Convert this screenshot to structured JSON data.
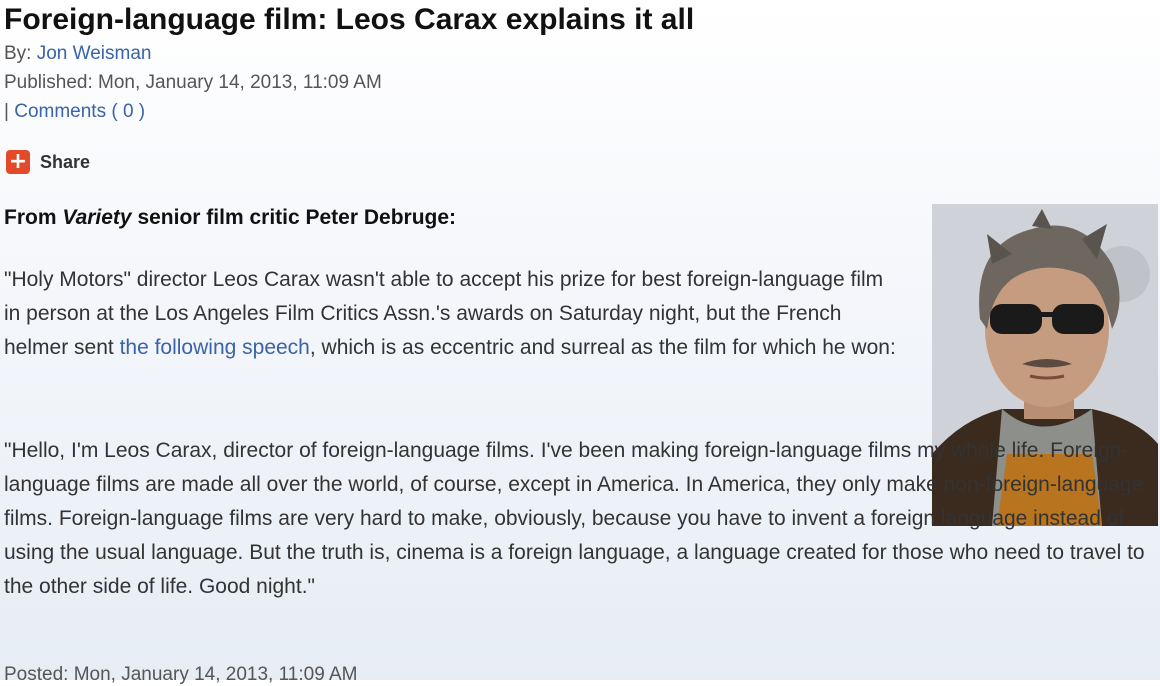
{
  "article": {
    "title": "Foreign-language film: Leos Carax explains it all",
    "byline_prefix": "By:",
    "author": "Jon Weisman",
    "published": "Published: Mon, January 14, 2013, 11:09 AM",
    "comments_prefix": "|",
    "comments_label": "Comments ( 0 )",
    "share_label": "Share",
    "share_icon": "plus-icon",
    "intro_prefix": "From ",
    "intro_italic": "Variety",
    "intro_suffix": " senior film critic Peter Debruge:",
    "p1_before": "\"Holy Motors\" director Leos Carax wasn't able to accept his prize for best foreign-language film in person at the Los Angeles Film Critics Assn.'s awards on Saturday night, but the French helmer sent ",
    "p1_link": "the following speech",
    "p1_after": ", which is as eccentric and surreal as the film for which he won:",
    "p2": "\"Hello, I'm Leos Carax, director of foreign-language films. I've been making foreign-language films my whole life. Foreign-language films are made all over the world, of course, except in America. In America, they only make non-foreign-language films. Foreign-language films are very hard to make, obviously, because you have to invent a foreign language instead of using the usual language. But the truth is, cinema is a foreign language, a language created for those who need to travel to the other side of life. Good night.\"",
    "posted": "Posted: Mon, January 14, 2013, 11:09 AM"
  },
  "colors": {
    "link": "#3a63a8",
    "share_icon_bg": "#e24a2a"
  }
}
